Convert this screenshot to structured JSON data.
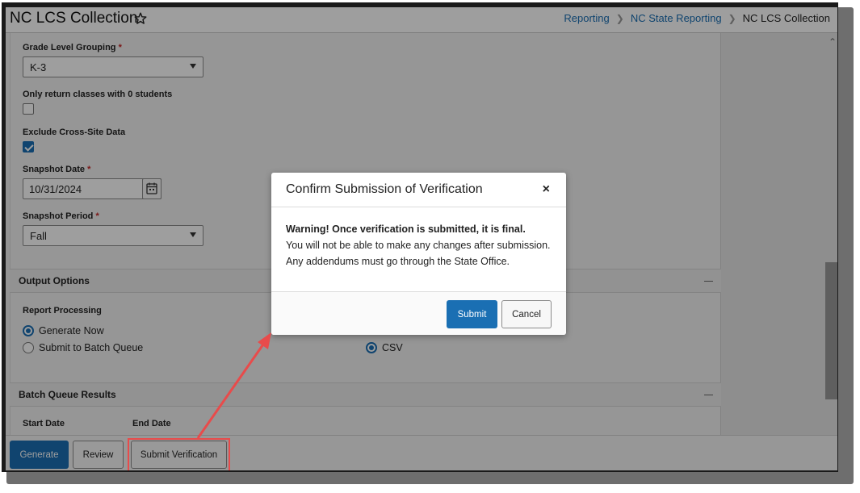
{
  "header": {
    "title": "NC LCS Collection",
    "breadcrumb": [
      "Reporting",
      "NC State Reporting",
      "NC LCS Collection"
    ]
  },
  "form": {
    "grade_level": {
      "label": "Grade Level Grouping",
      "required": "*",
      "value": "K-3"
    },
    "zero_students": {
      "label": "Only return classes with 0 students",
      "checked": false
    },
    "exclude_cross_site": {
      "label": "Exclude Cross-Site Data",
      "checked": true
    },
    "snapshot_date": {
      "label": "Snapshot Date",
      "required": "*",
      "value": "10/31/2024"
    },
    "snapshot_period": {
      "label": "Snapshot Period",
      "required": "*",
      "value": "Fall"
    }
  },
  "output_options": {
    "title": "Output Options",
    "report_processing_label": "Report Processing",
    "options": [
      "Generate Now",
      "Submit to Batch Queue"
    ],
    "selected": "Generate Now",
    "format_option": "CSV",
    "format_selected": true
  },
  "batch_queue": {
    "title": "Batch Queue Results",
    "start_date_label": "Start Date",
    "end_date_label": "End Date"
  },
  "actions": {
    "generate": "Generate",
    "review": "Review",
    "submit_verification": "Submit Verification"
  },
  "modal": {
    "title": "Confirm Submission of Verification",
    "close": "×",
    "warning": "Warning! Once verification is submitted, it is final.",
    "line1": "You will not be able to make any changes after submission.",
    "line2": "Any addendums must go through the State Office.",
    "submit": "Submit",
    "cancel": "Cancel"
  },
  "colors": {
    "accent": "#1a6fb3",
    "highlight": "#e84b4b"
  },
  "icons": {
    "favorite": "star-icon",
    "calendar": "calendar-icon",
    "close": "close-icon",
    "collapse": "collapse-icon"
  }
}
